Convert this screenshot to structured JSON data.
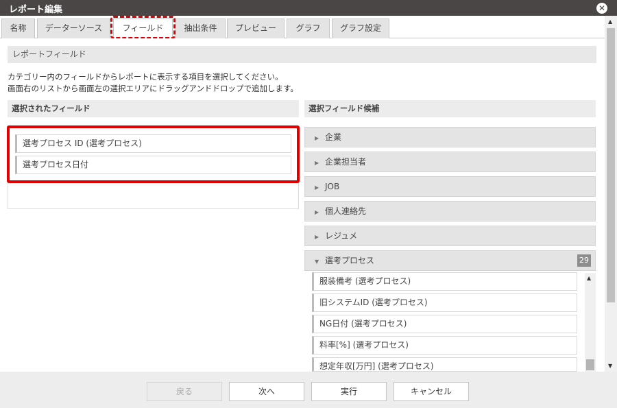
{
  "window": {
    "title": "レポート編集",
    "close_icon": "close-icon"
  },
  "tabs": [
    {
      "label": "名称"
    },
    {
      "label": "データーソース"
    },
    {
      "label": "フィールド",
      "active": true
    },
    {
      "label": "抽出条件"
    },
    {
      "label": "プレビュー"
    },
    {
      "label": "グラフ"
    },
    {
      "label": "グラフ設定"
    }
  ],
  "section": {
    "title": "レポートフィールド",
    "description_line1": "カテゴリー内のフィールドからレポートに表示する項目を選択してください。",
    "description_line2": "画面右のリストから画面左の選択エリアにドラッグアンドドロップで追加します。"
  },
  "selected": {
    "header": "選択されたフィールド",
    "items": [
      "選考プロセス ID (選考プロセス)",
      "選考プロセス日付"
    ]
  },
  "candidates": {
    "header": "選択フィールド候補",
    "categories": [
      {
        "label": "企業"
      },
      {
        "label": "企業担当者"
      },
      {
        "label": "JOB"
      },
      {
        "label": "個人連絡先"
      },
      {
        "label": "レジュメ"
      },
      {
        "label": "選考プロセス",
        "expanded": true,
        "count": "29"
      }
    ],
    "items": [
      "服装備考 (選考プロセス)",
      "旧システムID (選考プロセス)",
      "NG日付 (選考プロセス)",
      "料率[%] (選考プロセス)",
      "想定年収[万円] (選考プロセス)"
    ]
  },
  "footer": {
    "back": "戻る",
    "next": "次へ",
    "run": "実行",
    "cancel": "キャンセル"
  },
  "colors": {
    "highlight": "#e00000",
    "titlebar": "#4a4646"
  }
}
